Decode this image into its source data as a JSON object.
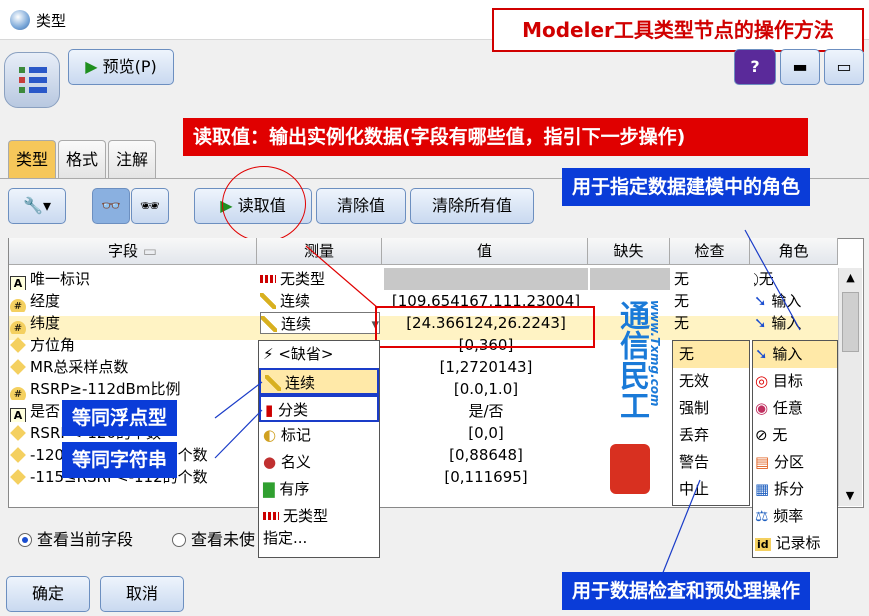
{
  "window": {
    "title": "类型"
  },
  "title_annotation": "Modeler工具类型节点的操作方法",
  "toolbar": {
    "preview_label": "预览(P)",
    "help_label": "?"
  },
  "tabs": [
    {
      "label": "类型"
    },
    {
      "label": "格式"
    },
    {
      "label": "注解"
    }
  ],
  "actions": {
    "read_values": "读取值",
    "clear_values": "清除值",
    "clear_all_values": "清除所有值"
  },
  "annotations": {
    "read_values": "读取值：输出实例化数据(字段有哪些值，指引下一步操作)",
    "role": "用于指定数据建模中的角色",
    "check": "用于数据检查和预处理操作",
    "float": "等同浮点型",
    "string": "等同字符串"
  },
  "grid": {
    "headers": {
      "field": "字段",
      "measure": "测量",
      "value": "值",
      "missing": "缺失",
      "check": "检查",
      "role": "角色"
    },
    "rows": [
      {
        "field": "唯一标识",
        "measure": "无类型",
        "value": "",
        "check": "无",
        "role": "无"
      },
      {
        "field": "经度",
        "measure": "连续",
        "value": "[109.654167,111.23004]",
        "check": "无",
        "role": "输入"
      },
      {
        "field": "纬度",
        "measure": "连续",
        "value": "[24.366124,26.2243]",
        "check": "无",
        "role": "输入"
      },
      {
        "field": "方位角",
        "value": "[0,360]"
      },
      {
        "field": "MR总采样点数",
        "value": "[1,2720143]"
      },
      {
        "field": "RSRP≥-112dBm比例",
        "value": "[0.0,1.0]"
      },
      {
        "field": "是否",
        "value": "是/否"
      },
      {
        "field": "RSRP<-120的个数",
        "value": "[0,0]"
      },
      {
        "field": "-120≤RSRP<-115的个数",
        "value": "[0,88648]"
      },
      {
        "field": "-115≤RSRP<-112的个数",
        "value": "[0,111695]"
      }
    ]
  },
  "measure_dropdown": [
    "<缺省>",
    "连续",
    "分类",
    "标记",
    "名义",
    "有序",
    "无类型",
    "指定..."
  ],
  "check_dropdown": [
    "无",
    "无效",
    "强制",
    "丢弃",
    "警告",
    "中止"
  ],
  "role_dropdown": [
    "输入",
    "目标",
    "任意",
    "无",
    "分区",
    "拆分",
    "频率",
    "记录标"
  ],
  "watermark": {
    "name": "通信民工",
    "url": "www.Txmg.com"
  },
  "view_options": {
    "current": "查看当前字段",
    "unused": "查看未使"
  },
  "footer": {
    "ok": "确定",
    "cancel": "取消"
  }
}
